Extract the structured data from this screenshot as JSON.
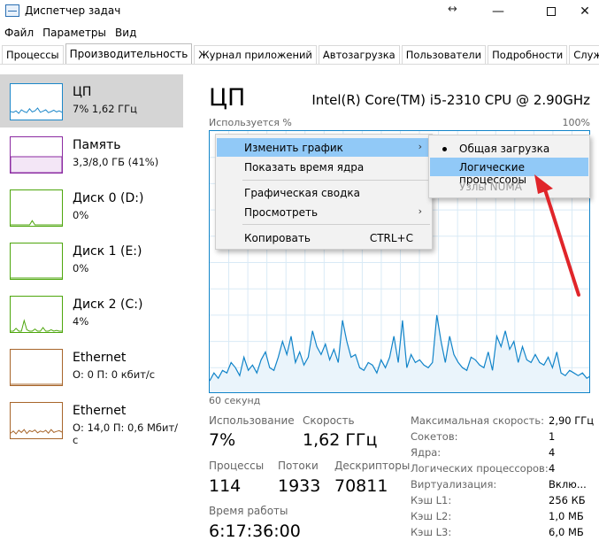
{
  "window": {
    "title": "Диспетчер задач",
    "resize_glyph": "↔",
    "min_glyph": "—",
    "close_glyph": "✕"
  },
  "menu": [
    "Файл",
    "Параметры",
    "Вид"
  ],
  "tabs": [
    "Процессы",
    "Производительность",
    "Журнал приложений",
    "Автозагрузка",
    "Пользователи",
    "Подробности",
    "Службы"
  ],
  "sidebar": [
    {
      "title": "ЦП",
      "sub": "7% 1,62 ГГц",
      "color": "#1c87c9"
    },
    {
      "title": "Память",
      "sub": "3,3/8,0 ГБ (41%)",
      "color": "#8b2aa1"
    },
    {
      "title": "Диск 0 (D:)",
      "sub": "0%",
      "color": "#4da60c"
    },
    {
      "title": "Диск 1 (E:)",
      "sub": "0%",
      "color": "#4da60c"
    },
    {
      "title": "Диск 2 (C:)",
      "sub": "4%",
      "color": "#4da60c"
    },
    {
      "title": "Ethernet",
      "sub": "О: 0 П: 0 кбит/с",
      "color": "#a7652a"
    },
    {
      "title": "Ethernet",
      "sub": "О: 14,0 П: 0,6 Мбит/с",
      "color": "#a7652a"
    }
  ],
  "cpu": {
    "title": "ЦП",
    "model": "Intel(R) Core(TM) i5-2310 CPU @ 2.90GHz",
    "used_label": "Используется %",
    "max_label": "100%",
    "time_label": "60 секунд",
    "graph_values": [
      5,
      8,
      6,
      9,
      8,
      12,
      10,
      7,
      14,
      9,
      11,
      8,
      13,
      16,
      10,
      9,
      14,
      20,
      15,
      22,
      12,
      16,
      11,
      14,
      24,
      18,
      15,
      19,
      13,
      17,
      12,
      28,
      20,
      14,
      15,
      10,
      9,
      12,
      11,
      8,
      13,
      10,
      14,
      22,
      12,
      28,
      10,
      15,
      12,
      13,
      11,
      10,
      12,
      30,
      20,
      12,
      22,
      15,
      12,
      10,
      9,
      14,
      13,
      11,
      10,
      16,
      9,
      22,
      18,
      24,
      17,
      20,
      12,
      18,
      13,
      12,
      15,
      12,
      11,
      14,
      10,
      16,
      8,
      7,
      9,
      8,
      7,
      8,
      6,
      7
    ],
    "color": "#1184c9"
  },
  "stats": {
    "usage_label": "Использование",
    "usage_value": "7%",
    "speed_label": "Скорость",
    "speed_value": "1,62 ГГц",
    "proc_label": "Процессы",
    "proc_value": "114",
    "threads_label": "Потоки",
    "threads_value": "1933",
    "handles_label": "Дескрипторы",
    "handles_value": "70811",
    "uptime_label": "Время работы",
    "uptime_value": "6:17:36:00"
  },
  "details": [
    {
      "key": "Максимальная скорость:",
      "value": "2,90 ГГц"
    },
    {
      "key": "Сокетов:",
      "value": "1"
    },
    {
      "key": "Ядра:",
      "value": "4"
    },
    {
      "key": "Логических процессоров:",
      "value": "4"
    },
    {
      "key": "Виртуализация:",
      "value": "Вклю..."
    },
    {
      "key": "Кэш L1:",
      "value": "256 КБ"
    },
    {
      "key": "Кэш L2:",
      "value": "1,0 МБ"
    },
    {
      "key": "Кэш L3:",
      "value": "6,0 МБ"
    }
  ],
  "context_menu": {
    "change_graph": "Изменить график",
    "show_kernel": "Показать время ядра",
    "summary": "Графическая сводка",
    "view": "Просмотреть",
    "copy": "Копировать",
    "copy_shortcut": "CTRL+C",
    "arrow": "›"
  },
  "submenu": {
    "overall": "Общая загрузка",
    "logical": "Логические процессоры",
    "numa": "Узлы NUMA"
  },
  "annotation_color": "#e0252a"
}
